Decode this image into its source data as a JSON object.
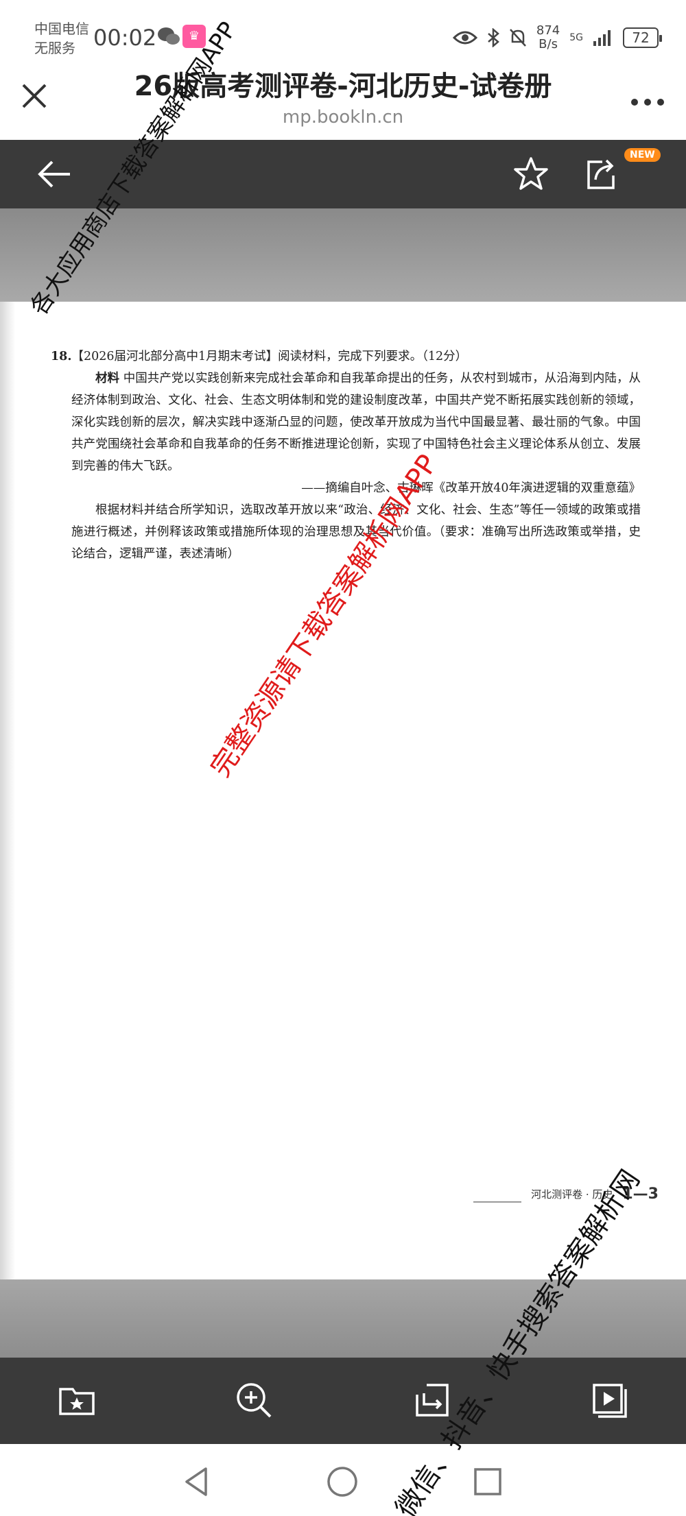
{
  "status_bar": {
    "carrier_line1": "中国电信",
    "carrier_line2": "无服务",
    "time": "00:02",
    "speed_value": "874",
    "speed_unit": "B/s",
    "network": "5G",
    "battery": "72"
  },
  "header": {
    "title": "26版高考测评卷-河北历史-试卷册",
    "url": "mp.bookln.cn"
  },
  "toolbar": {
    "new_badge": "NEW"
  },
  "document": {
    "q_number": "18.",
    "q_heading": "【2026届河北部分高中1月期末考试】阅读材料，完成下列要求。（12分）",
    "material_label": "材料",
    "material_text": "中国共产党以实践创新来完成社会革命和自我革命提出的任务，从农村到城市，从沿海到内陆，从经济体制到政治、文化、社会、生态文明体制和党的建设制度改革，中国共产党不断拓展实践创新的领域，深化实践创新的层次，解决实践中逐渐凸显的问题，使改革开放成为当代中国最显著、最壮丽的气象。中国共产党围绕社会革命和自我革命的任务不断推进理论创新，实现了中国特色社会主义理论体系从创立、发展到完善的伟大飞跃。",
    "source": "——摘编自叶念、古琳晖《改革开放40年演进逻辑的双重意蕴》",
    "task_text": "根据材料并结合所学知识，选取改革开放以来“政治、经济、文化、社会、生态”等任一领域的政策或措施进行概述，并例释该政策或措施所体现的治理思想及其当代价值。（要求：准确写出所选政策或举措，史论结合，逻辑严谨，表述清晰）",
    "footer_series": "河北测评卷 · 历史",
    "footer_page": "1—3"
  },
  "watermarks": {
    "top": "各大应用商店下载答案解析网APP",
    "center": "完整资源请下载答案解析网APP",
    "bottom": "微信、抖音、快手搜索答案解析网"
  },
  "colors": {
    "toolbar_bg": "#3a3a3a",
    "badge_orange": "#ff8c1a",
    "watermark_red": "#e01b1b"
  }
}
